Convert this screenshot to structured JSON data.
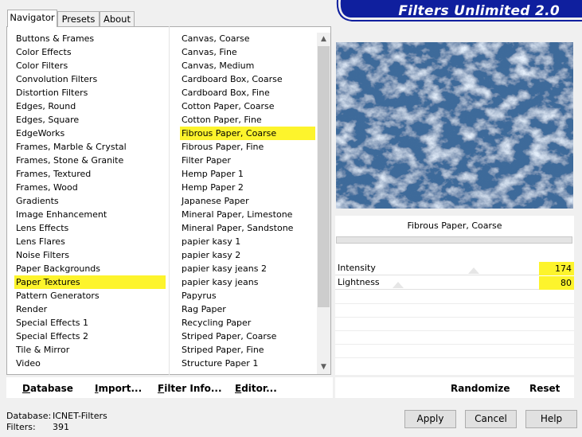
{
  "tabs": [
    "Navigator",
    "Presets",
    "About"
  ],
  "title": "Filters Unlimited 2.0",
  "categories": [
    "Buttons & Frames",
    "Color Effects",
    "Color Filters",
    "Convolution Filters",
    "Distortion Filters",
    "Edges, Round",
    "Edges, Square",
    "EdgeWorks",
    "Frames, Marble & Crystal",
    "Frames, Stone & Granite",
    "Frames, Textured",
    "Frames, Wood",
    "Gradients",
    "Image Enhancement",
    "Lens Effects",
    "Lens Flares",
    "Noise Filters",
    "Paper Backgrounds",
    "Paper Textures",
    "Pattern Generators",
    "Render",
    "Special Effects 1",
    "Special Effects 2",
    "Tile & Mirror",
    "Video"
  ],
  "selected_category": "Paper Textures",
  "filters": [
    "Canvas, Coarse",
    "Canvas, Fine",
    "Canvas, Medium",
    "Cardboard Box, Coarse",
    "Cardboard Box, Fine",
    "Cotton Paper, Coarse",
    "Cotton Paper, Fine",
    "Fibrous Paper, Coarse",
    "Fibrous Paper, Fine",
    "Filter Paper",
    "Hemp Paper 1",
    "Hemp Paper 2",
    "Japanese Paper",
    "Mineral Paper, Limestone",
    "Mineral Paper, Sandstone",
    "papier kasy 1",
    "papier kasy 2",
    "papier kasy jeans 2",
    "papier kasy jeans",
    "Papyrus",
    "Rag Paper",
    "Recycling Paper",
    "Striped Paper, Coarse",
    "Striped Paper, Fine",
    "Structure Paper 1"
  ],
  "selected_filter": "Fibrous Paper, Coarse",
  "filter_name_label": "Fibrous Paper, Coarse",
  "params": [
    {
      "label": "Intensity",
      "value": "174",
      "level": 0.68
    },
    {
      "label": "Lightness",
      "value": "80",
      "level": 0.31
    }
  ],
  "bottom_buttons": {
    "database": {
      "ul": "D",
      "rest": "atabase"
    },
    "import": {
      "ul": "I",
      "rest": "mport..."
    },
    "filter_info": {
      "ul": "F",
      "rest": "ilter Info..."
    },
    "editor": {
      "ul": "E",
      "rest": "ditor..."
    },
    "randomize": "Randomize",
    "reset": "Reset"
  },
  "status": {
    "database_label": "Database:",
    "database_value": "ICNET-Filters",
    "filters_label": "Filters:",
    "filters_value": "391"
  },
  "dialog_buttons": {
    "apply": "Apply",
    "cancel": "Cancel",
    "help": "Help"
  },
  "colors": {
    "highlight": "#fdf42c",
    "banner": "#0f1f9e",
    "preview_base": "#3d6a9a"
  },
  "icons": {
    "scroll_up": "chevron-up-icon",
    "scroll_down": "chevron-down-icon"
  }
}
